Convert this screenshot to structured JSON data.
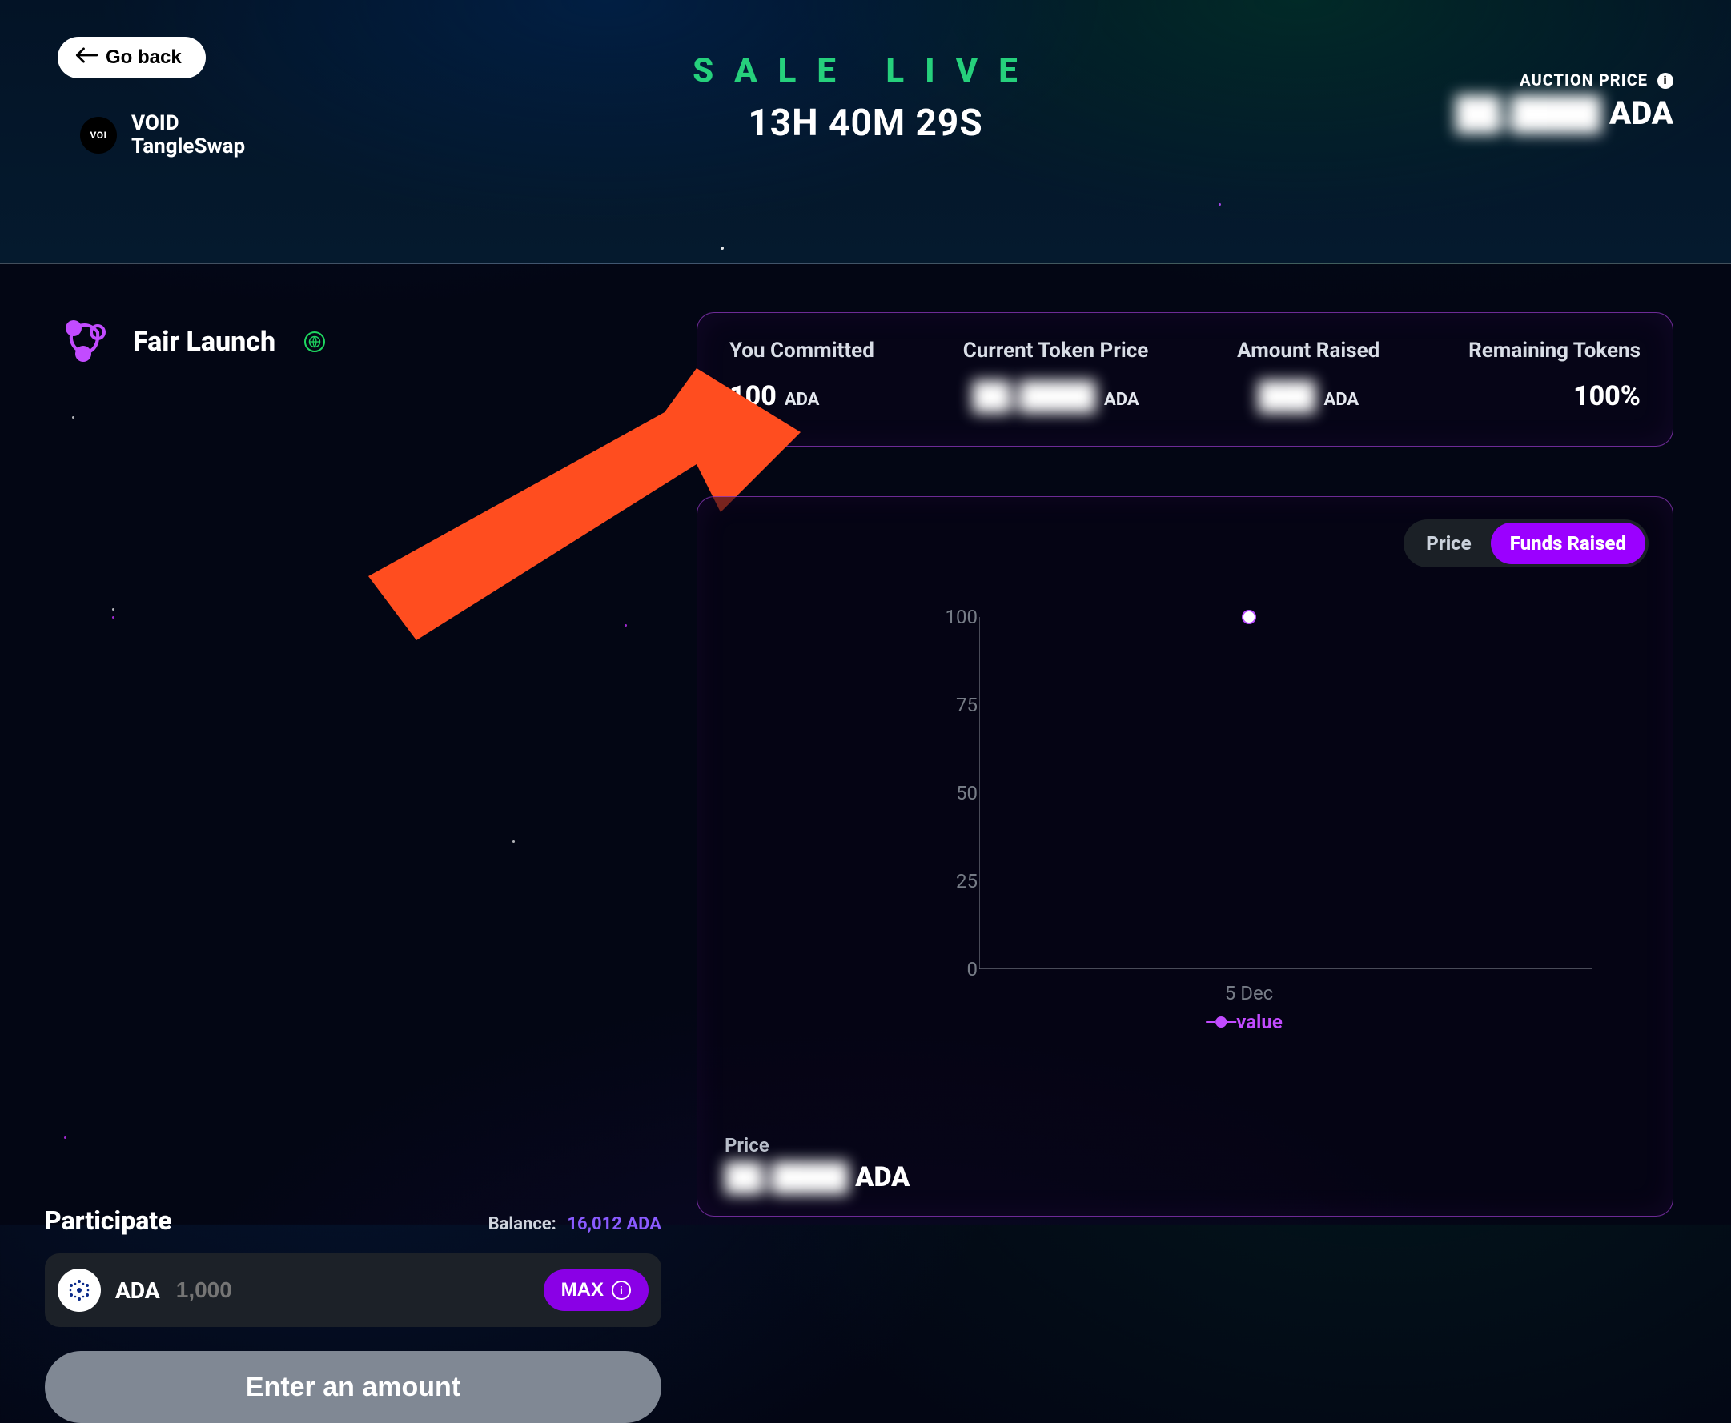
{
  "header": {
    "go_back_label": "Go back",
    "token_symbol": "VOID",
    "token_badge_text": "VOI",
    "project_name": "TangleSwap",
    "sale_live_label": "SALE LIVE",
    "countdown": "13H 40M 29S",
    "auction_price_label": "AUCTION PRICE",
    "auction_price_currency": "ADA",
    "auction_price_value_masked": "██.████"
  },
  "launch": {
    "title": "Fair Launch"
  },
  "stats": {
    "you_committed": {
      "label": "You Committed",
      "value": "100",
      "unit": "ADA"
    },
    "current_price": {
      "label": "Current Token Price",
      "value_masked": "██.████",
      "unit": "ADA"
    },
    "amount_raised": {
      "label": "Amount Raised",
      "value_masked": "███",
      "unit": "ADA"
    },
    "remaining_tokens": {
      "label": "Remaining Tokens",
      "value": "100%"
    }
  },
  "chart_toggle": {
    "price": "Price",
    "funds_raised": "Funds Raised",
    "active": "funds_raised"
  },
  "chart_data": {
    "type": "scatter",
    "title": "",
    "xlabel": "",
    "ylabel": "",
    "ylim": [
      0,
      100
    ],
    "y_ticks": [
      0,
      25,
      50,
      75,
      100
    ],
    "x_ticks": [
      "5 Dec"
    ],
    "legend": [
      "value"
    ],
    "series": [
      {
        "name": "value",
        "points": [
          {
            "x": "5 Dec",
            "y": 100
          }
        ]
      }
    ]
  },
  "price_footer": {
    "label": "Price",
    "value_masked": "██.████",
    "currency": "ADA"
  },
  "participate": {
    "title": "Participate",
    "balance_label": "Balance:",
    "balance_amount": "16,012 ADA",
    "coin_symbol": "ADA",
    "input_placeholder": "1,000",
    "max_label": "MAX",
    "enter_button_label": "Enter an amount"
  }
}
